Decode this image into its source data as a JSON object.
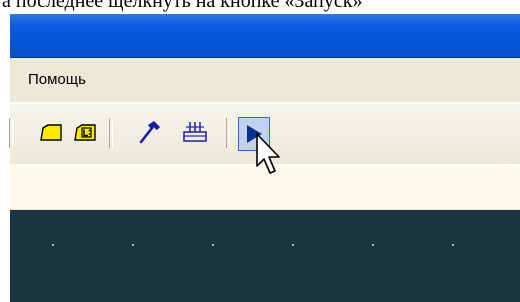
{
  "caption": "а последнее щелкнуть на кнопке «Запуск»",
  "menu": {
    "items": [
      "Помощь"
    ]
  },
  "toolbar": {
    "buttons": [
      {
        "icon": "open-folder-icon"
      },
      {
        "icon": "library-folder-icon"
      },
      {
        "icon": "hammer-icon"
      },
      {
        "icon": "build-all-icon"
      },
      {
        "icon": "run-icon",
        "active": true
      }
    ]
  },
  "colors": {
    "titlebar": "#0a5ae0",
    "menubar": "#ece9d8",
    "canvas": "#1b3442",
    "run_button_highlight": "#c1d2ee"
  }
}
